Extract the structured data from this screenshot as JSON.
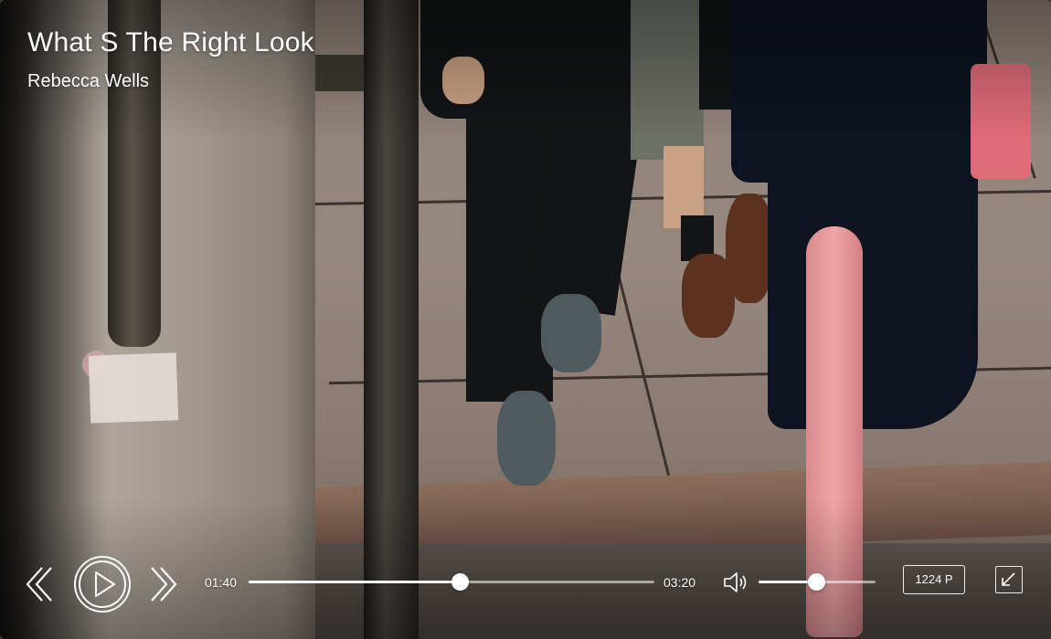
{
  "media": {
    "title": "What S The Right Look",
    "artist": "Rebecca Wells"
  },
  "playback": {
    "elapsed": "01:40",
    "duration": "03:20",
    "progress_percent": 52,
    "volume_percent": 49,
    "quality": "1224 P"
  },
  "icons": {
    "previous": "chevron-double-left-icon",
    "play": "play-circle-icon",
    "next": "chevron-double-right-icon",
    "volume": "speaker-icon",
    "fullscreen": "expand-icon"
  },
  "colors": {
    "overlay_text": "#ffffff",
    "track": "#ffffff"
  }
}
